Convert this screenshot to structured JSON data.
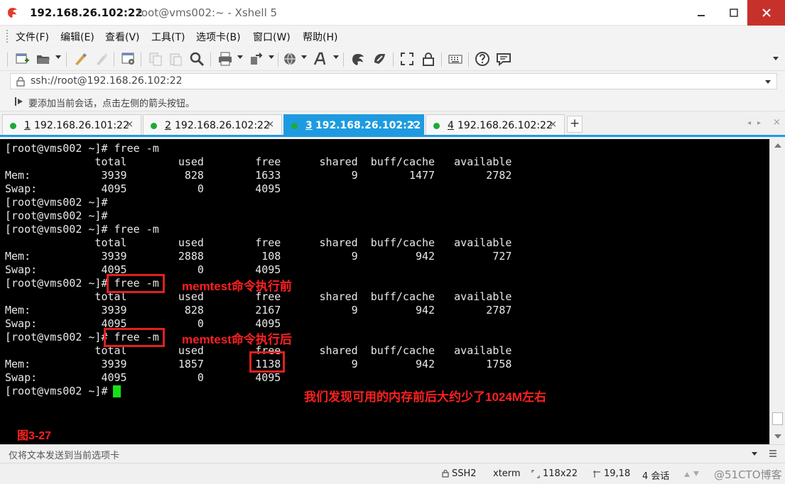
{
  "window": {
    "title_host": "192.168.26.102:22",
    "title_rest": "root@vms002:~ - Xshell 5",
    "colors": {
      "close_button": "#c7312b",
      "active_tab": "#1e9be0",
      "annotation": "#ff2020",
      "cursor": "#16e016"
    }
  },
  "menu": [
    "文件(F)",
    "编辑(E)",
    "查看(V)",
    "工具(T)",
    "选项卡(B)",
    "窗口(W)",
    "帮助(H)"
  ],
  "toolbar_icons": [
    "new-session-icon",
    "open-folder-icon",
    "edit-icon",
    "color-icon",
    "session-properties-icon",
    "copy-icon",
    "paste-icon",
    "find-icon",
    "print-icon",
    "transfer-icon",
    "globe-icon",
    "font-icon",
    "xftp-icon",
    "xmanager-icon",
    "fullscreen-icon",
    "lock-icon",
    "keyboard-icon",
    "help-icon",
    "chat-icon"
  ],
  "address": {
    "text": "ssh://root@192.168.26.102:22"
  },
  "hint": {
    "text": "要添加当前会话，点击左侧的箭头按钮。"
  },
  "tabs": [
    {
      "num": "1",
      "label": "192.168.26.101:22",
      "active": false
    },
    {
      "num": "2",
      "label": "192.168.26.102:22",
      "active": false
    },
    {
      "num": "3",
      "label": "192.168.26.102:22",
      "active": true
    },
    {
      "num": "4",
      "label": "192.168.26.102:22",
      "active": false
    }
  ],
  "tab_add": "+",
  "tab_nav_prev": "◂",
  "tab_nav_next": "▸",
  "tab_close": "×",
  "terminal": {
    "lines": [
      "[root@vms002 ~]# free -m",
      "              total        used        free      shared  buff/cache   available",
      "Mem:           3939         828        1633           9        1477        2782",
      "Swap:          4095           0        4095",
      "[root@vms002 ~]#",
      "[root@vms002 ~]#",
      "[root@vms002 ~]# free -m",
      "              total        used        free      shared  buff/cache   available",
      "Mem:           3939        2888         108           9         942         727",
      "Swap:          4095           0        4095",
      "[root@vms002 ~]# free -m",
      "              total        used        free      shared  buff/cache   available",
      "Mem:           3939         828        2167           9         942        2787",
      "Swap:          4095           0        4095",
      "[root@vms002 ~]# free -m",
      "              total        used        free      shared  buff/cache   available",
      "Mem:           3939        1857        1138           9         942        1758",
      "Swap:          4095           0        4095",
      "[root@vms002 ~]# "
    ]
  },
  "annotations": {
    "before": "memtest命令执行前",
    "after": "memtest命令执行后",
    "conclusion": "我们发现可用的内存前后大约少了1024M左右",
    "figure": "图3-27"
  },
  "input_bar": {
    "text": "仅将文本发送到当前选项卡"
  },
  "status": {
    "protocol": "SSH2",
    "term": "xterm",
    "size": "118x22",
    "pos": "19,18",
    "sessions": "4 会话"
  },
  "watermark": "@51CTO博客"
}
